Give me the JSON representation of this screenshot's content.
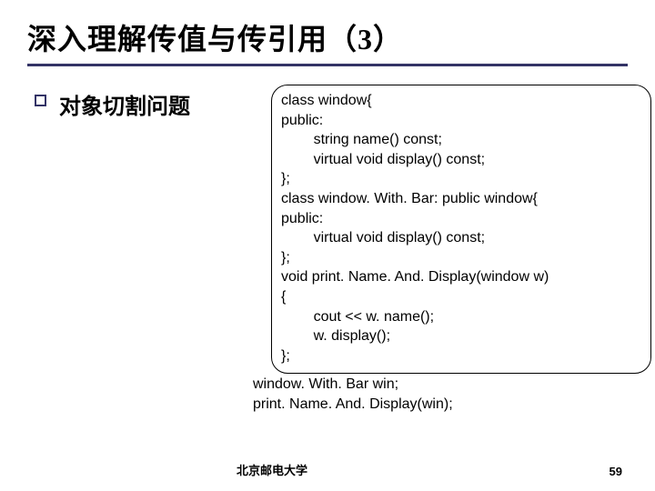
{
  "title": "深入理解传值与传引用（3）",
  "bullet": "对象切割问题",
  "code_block": "class window{\npublic:\n        string name() const;\n        virtual void display() const;\n};\nclass window. With. Bar: public window{\npublic:\n        virtual void display() const;\n};\nvoid print. Name. And. Display(window w)\n{\n        cout << w. name();\n        w. display();\n};",
  "code_below": "window. With. Bar win;\nprint. Name. And. Display(win);",
  "footer_org": "北京邮电大学",
  "footer_page": "59"
}
